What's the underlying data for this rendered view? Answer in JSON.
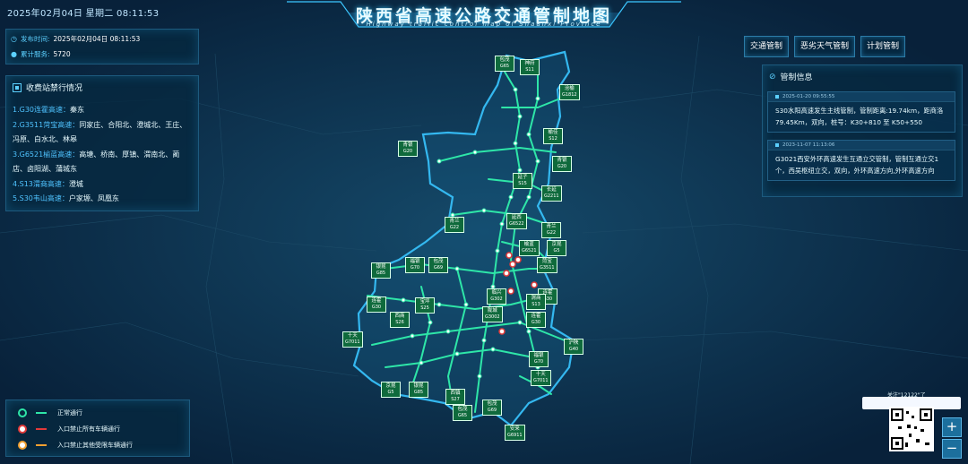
{
  "header": {
    "datetime": "2025年02月04日 星期二   08:11:53",
    "title": "陕西省高速公路交通管制地图",
    "subtitle": "Highway traffic control map of Shaanxi Province"
  },
  "info": {
    "publish_label": "发布时间:",
    "publish_value": "2025年02月04日 08:11:53",
    "service_label": "累计服务:",
    "service_value": "5720"
  },
  "toll": {
    "title": "收费站禁行情况",
    "items": [
      {
        "road": "1.G30连霍高速：",
        "stations": "秦东"
      },
      {
        "road": "2.G3511菏宝高速：",
        "stations": "同家庄、合阳北、澄城北、王庄、冯原、白水北、林皋"
      },
      {
        "road": "3.G6521榆蓝高速：",
        "stations": "高塘、桥南、厚镇、渭南北、蔺店、卤阳湖、蒲城东"
      },
      {
        "road": "4.S13渭商高速：",
        "stations": "澄城"
      },
      {
        "road": "5.S30韦山高速：",
        "stations": "户家塬、凤凰东"
      }
    ]
  },
  "tabs": [
    "交通管制",
    "恶劣天气管制",
    "计划管制"
  ],
  "control": {
    "title": "管制信息",
    "items": [
      {
        "time": "2025-01-20 09:55:55",
        "text": "S30水阳高速发生主线管制，管制距离:19.74km，距商洛79.45Km，双向，桩号：K30+810 至 K50+550"
      },
      {
        "time": "2023-11-07 11:13:06",
        "text": "G3021西安外环高速发生互通立交管制，管制互通立交1个，西吴枢纽立交，双向，外环高速方向,外环高速方向"
      }
    ]
  },
  "legend": [
    {
      "label": "正常通行",
      "color": "#2ee6a8"
    },
    {
      "label": "入口禁止所有车辆通行",
      "color": "#e23a3a"
    },
    {
      "label": "入口禁止其他受限车辆通行",
      "color": "#f0a030"
    }
  ],
  "follow_text": "关注\"12122\"了",
  "zoom": {
    "in": "+",
    "out": "−"
  },
  "roads": [
    {
      "name": "包茂",
      "code": "G65"
    },
    {
      "name": "神府",
      "code": "S11"
    },
    {
      "name": "沧榆",
      "code": "G1812"
    },
    {
      "name": "榆佳",
      "code": "S12"
    },
    {
      "name": "青银",
      "code": "G20"
    },
    {
      "name": "青银",
      "code": "G20"
    },
    {
      "name": "延子",
      "code": "S15"
    },
    {
      "name": "长延",
      "code": "G2211"
    },
    {
      "name": "青兰",
      "code": "G22"
    },
    {
      "name": "延西",
      "code": "G6522"
    },
    {
      "name": "青兰",
      "code": "G22"
    },
    {
      "name": "榆蓝",
      "code": "G6521"
    },
    {
      "name": "京昆",
      "code": "G5"
    },
    {
      "name": "菏宝",
      "code": "G3511"
    },
    {
      "name": "银昆",
      "code": "G85"
    },
    {
      "name": "福银",
      "code": "G70"
    },
    {
      "name": "包茂",
      "code": "G69"
    },
    {
      "name": "连霍",
      "code": "G30"
    },
    {
      "name": "连霍",
      "code": "G30"
    },
    {
      "name": "临兴",
      "code": "G302"
    },
    {
      "name": "陇城",
      "code": "G3002"
    },
    {
      "name": "连霍",
      "code": "G30"
    },
    {
      "name": "西商",
      "code": "S26"
    },
    {
      "name": "渭商",
      "code": "S13"
    },
    {
      "name": "宝坪",
      "code": "S25"
    },
    {
      "name": "十天",
      "code": "G7011"
    },
    {
      "name": "沪陕",
      "code": "G40"
    },
    {
      "name": "福银",
      "code": "G70"
    },
    {
      "name": "十天",
      "code": "G7011"
    },
    {
      "name": "京昆",
      "code": "G5"
    },
    {
      "name": "银昆",
      "code": "G85"
    },
    {
      "name": "西镇",
      "code": "S27"
    },
    {
      "name": "包茂",
      "code": "G65"
    },
    {
      "name": "包茂",
      "code": "G69"
    },
    {
      "name": "安来",
      "code": "G6911"
    }
  ]
}
